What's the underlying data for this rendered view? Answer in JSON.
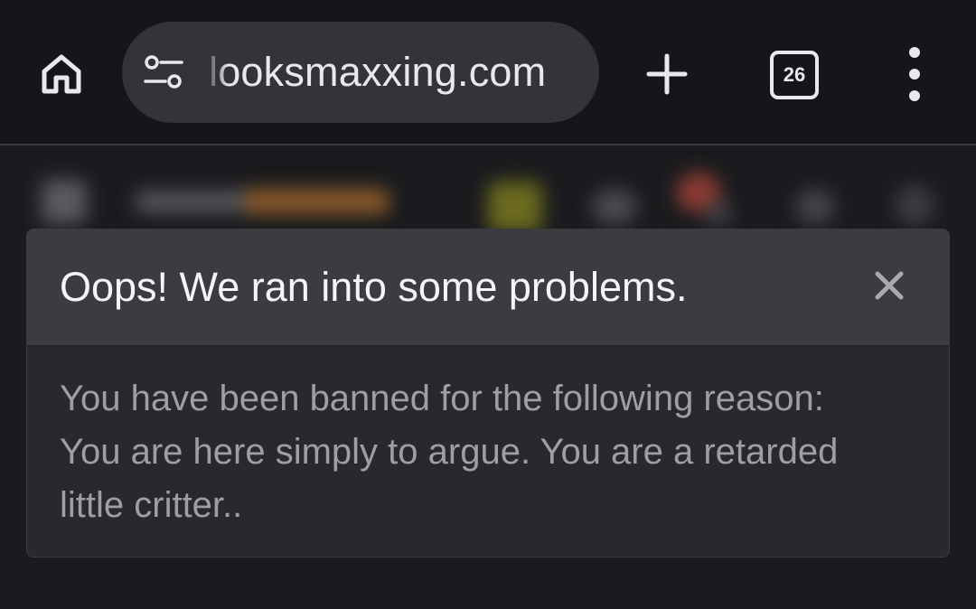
{
  "browser": {
    "url": "looksmaxxing.com",
    "tab_count": "26",
    "icons": {
      "home": "home-icon",
      "site_info": "tune-icon",
      "new_tab": "plus-icon",
      "tab_switcher": "tab-switcher-icon",
      "menu": "more-vert-icon"
    }
  },
  "dialog": {
    "title": "Oops! We ran into some problems.",
    "close_icon": "close-icon",
    "body_lines": [
      "You have been banned for the following reason:",
      "You are here simply to argue. You are a retarded",
      "little critter.."
    ]
  },
  "colors": {
    "toolbar_bg": "#15161a",
    "url_bar_bg": "#333438",
    "dialog_header_bg": "#3b3c40",
    "dialog_body_bg": "#28292d",
    "title_text": "#f4f5f7",
    "body_text": "#9d9fa5"
  }
}
